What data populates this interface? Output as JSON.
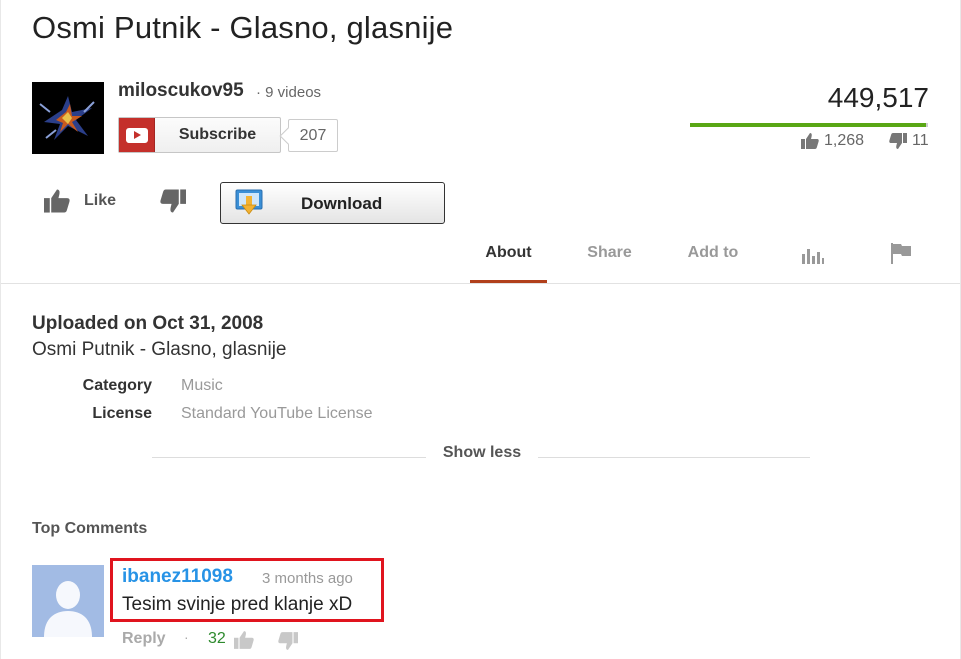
{
  "video": {
    "title": "Osmi Putnik - Glasno, glasnije",
    "view_count": "449,517",
    "like_count": "1,268",
    "dislike_count": "11",
    "like_ratio": 0.991
  },
  "channel": {
    "name": "miloscukov95",
    "video_count": "· 9 videos",
    "subscribe_label": "Subscribe",
    "subscriber_count": "207"
  },
  "actions": {
    "like_label": "Like",
    "download_label": "Download"
  },
  "tabs": [
    {
      "label": "About",
      "active": true
    },
    {
      "label": "Share",
      "active": false
    },
    {
      "label": "Add to",
      "active": false
    },
    {
      "icon": "stats-icon"
    },
    {
      "icon": "flag-icon"
    }
  ],
  "about": {
    "upload_date": "Uploaded on Oct 31, 2008",
    "description": "Osmi Putnik - Glasno, glasnije",
    "meta": [
      {
        "label": "Category",
        "value": "Music"
      },
      {
        "label": "License",
        "value": "Standard YouTube License"
      }
    ],
    "show_less_label": "Show less"
  },
  "comments": {
    "heading": "Top Comments",
    "items": [
      {
        "author": "ibanez11098",
        "time": "3 months ago",
        "text": "Tesim svinje pred klanje xD",
        "reply_label": "Reply",
        "separator": "·",
        "likes": "32"
      }
    ]
  },
  "colors": {
    "rating_green": "#59a715",
    "active_tab_underline": "#b1401b",
    "author_link": "#2793e6",
    "highlight_border": "#e0141e",
    "comment_likes": "#2d8a2d"
  }
}
